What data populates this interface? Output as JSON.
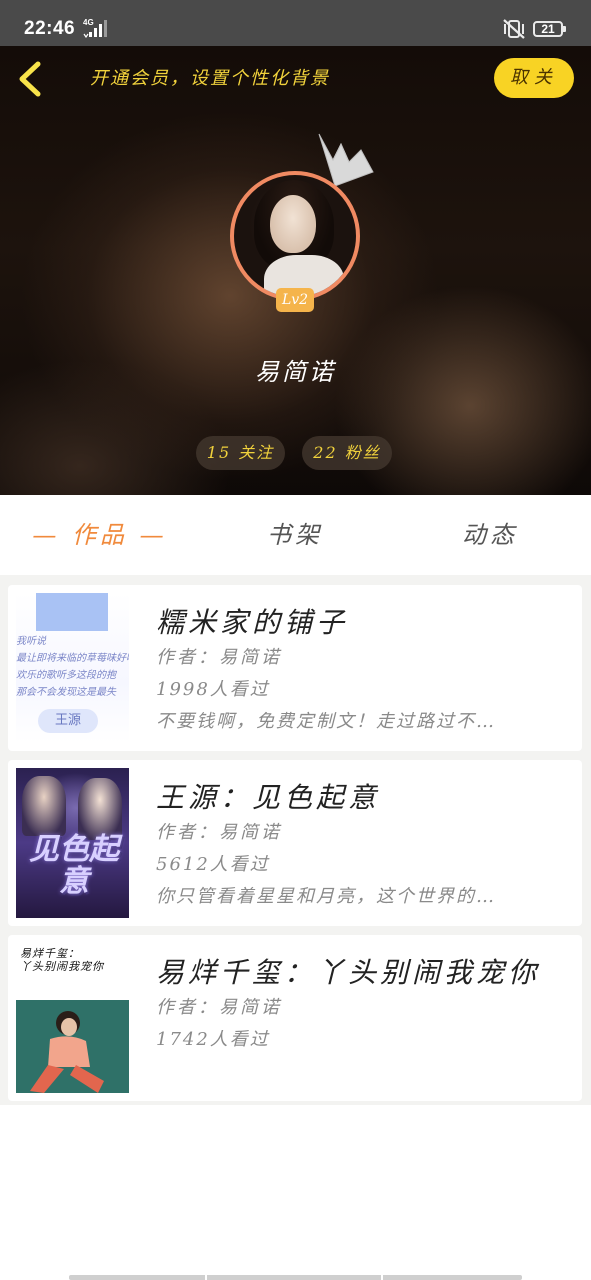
{
  "status_bar": {
    "time": "22:46",
    "network": "4G",
    "battery": "21"
  },
  "header": {
    "vip_promo": "开通会员，设置个性化背景",
    "follow_button": "取关",
    "level": "Lv2",
    "username": "易简诺",
    "following": "15 关注",
    "followers": "22 粉丝"
  },
  "tabs": [
    {
      "label": "— 作品 —",
      "active": true
    },
    {
      "label": "书架",
      "active": false
    },
    {
      "label": "动态",
      "active": false
    }
  ],
  "works": [
    {
      "title": "糯米家的铺子",
      "author": "作者：易简诺",
      "views": "1998人看过",
      "desc": "不要钱啊，免费定制文！走过路过不…",
      "cover_text": [
        "我听说",
        "最让即将来临的草莓味好吃",
        "欢乐的歌听多这段的抱",
        "那会不会发现这是最失",
        "王源"
      ]
    },
    {
      "title": "王源：见色起意",
      "author": "作者：易简诺",
      "views": "5612人看过",
      "desc": "你只管看着星星和月亮，这个世界的…",
      "cover_text": "见色起意"
    },
    {
      "title": "易烊千玺：丫头别闹我宠你",
      "author": "作者：易简诺",
      "views": "1742人看过",
      "desc": "",
      "cover_text": [
        "易烊千玺：",
        "丫头别闹我宠你"
      ]
    }
  ],
  "colors": {
    "accent": "#f08a3c",
    "yellow": "#f8d324",
    "promo_text": "#f1d23c",
    "avatar_border": "#f08a62"
  }
}
